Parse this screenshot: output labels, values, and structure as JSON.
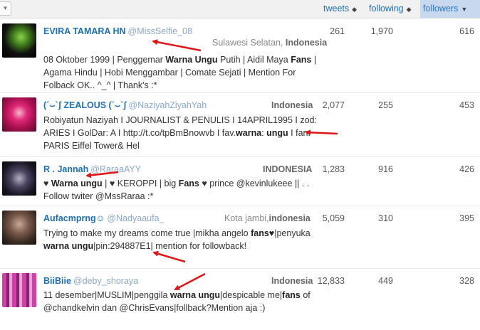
{
  "header": {
    "columns": {
      "tweets": "tweets",
      "following": "following",
      "followers": "followers"
    },
    "sort_icon": "sort-arrows-icon",
    "active_sort_icon": "caret-down-icon"
  },
  "colors": {
    "link": "#1e6fb5",
    "handle": "#8aa8cc",
    "annotation_arrow": "#e01515",
    "active_header": "#c8d8ee"
  },
  "rows": [
    {
      "name": "EVIRA TAMARA HN",
      "handle": "@MissSelfie_08",
      "location_prefix": "Sulawesi Selatan, ",
      "location_bold": "Indonesia",
      "bio": [
        {
          "t": "08 Oktober 1999 | Penggemar "
        },
        {
          "t": "Warna Ungu",
          "b": true
        },
        {
          "t": " Putih | Aidil Maya "
        },
        {
          "t": "Fans",
          "b": true
        },
        {
          "t": " | Agama Hindu | Hobi Menggambar | Comate Sejati | Mention For Folback OK.. ^_^ | Thank's :*"
        }
      ],
      "tweets": "261",
      "following": "1,970",
      "followers": "616"
    },
    {
      "name": "(´⌣`ʃ ZEALOUS (´⌣`ʃ",
      "handle": "@NaziyahZiyahYah",
      "location_prefix": "",
      "location_bold": "Indonesia",
      "bio": [
        {
          "t": "Robiyatun Naziyah I JOURNALIST & PENULIS I 14APRIL1995 I zod: ARIES I GolDar: A I http://t.co/tpBmBnowvb I fav."
        },
        {
          "t": "warna",
          "b": true
        },
        {
          "t": ": "
        },
        {
          "t": "ungu",
          "b": true
        },
        {
          "t": " I fan: PARIS Eiffel Tower& Hel"
        }
      ],
      "tweets": "2,077",
      "following": "255",
      "followers": "453"
    },
    {
      "name": "R . Jannah",
      "handle": "@RaraaAYY",
      "location_prefix": "",
      "location_bold": "INDONESIA",
      "bio": [
        {
          "t": "♥ "
        },
        {
          "t": "Warna ungu",
          "b": true
        },
        {
          "t": " | ♥ KEROPPI | big "
        },
        {
          "t": "Fans",
          "b": true
        },
        {
          "t": " ♥ prince @kevinlukeee || . . Follow twiter @MssRaraa :*"
        }
      ],
      "tweets": "1,283",
      "following": "916",
      "followers": "426"
    },
    {
      "name": "Aufacmprng☺",
      "handle": "@Nadyaaufa_",
      "location_prefix": "Kota jambi,",
      "location_bold": "indonesia",
      "bio": [
        {
          "t": "Trying to make my dreams come true |mikha angelo "
        },
        {
          "t": "fans♥",
          "b": true
        },
        {
          "t": "|penyuka "
        },
        {
          "t": "warna ungu",
          "b": true
        },
        {
          "t": "|pin:294887E1| mention for followback!"
        }
      ],
      "tweets": "5,059",
      "following": "310",
      "followers": "395"
    },
    {
      "name": "BiiBiie",
      "handle": "@deby_shoraya",
      "location_prefix": "",
      "location_bold": "Indonesia",
      "bio": [
        {
          "t": "11 desember|MUSLIM|penggila "
        },
        {
          "t": "warna ungu",
          "b": true
        },
        {
          "t": "|despicable me|"
        },
        {
          "t": "fans",
          "b": true
        },
        {
          "t": " of @chandkelvin dan @ChrisEvans|follback?Mention aja :)"
        }
      ],
      "tweets": "12,833",
      "following": "449",
      "followers": "328"
    }
  ]
}
